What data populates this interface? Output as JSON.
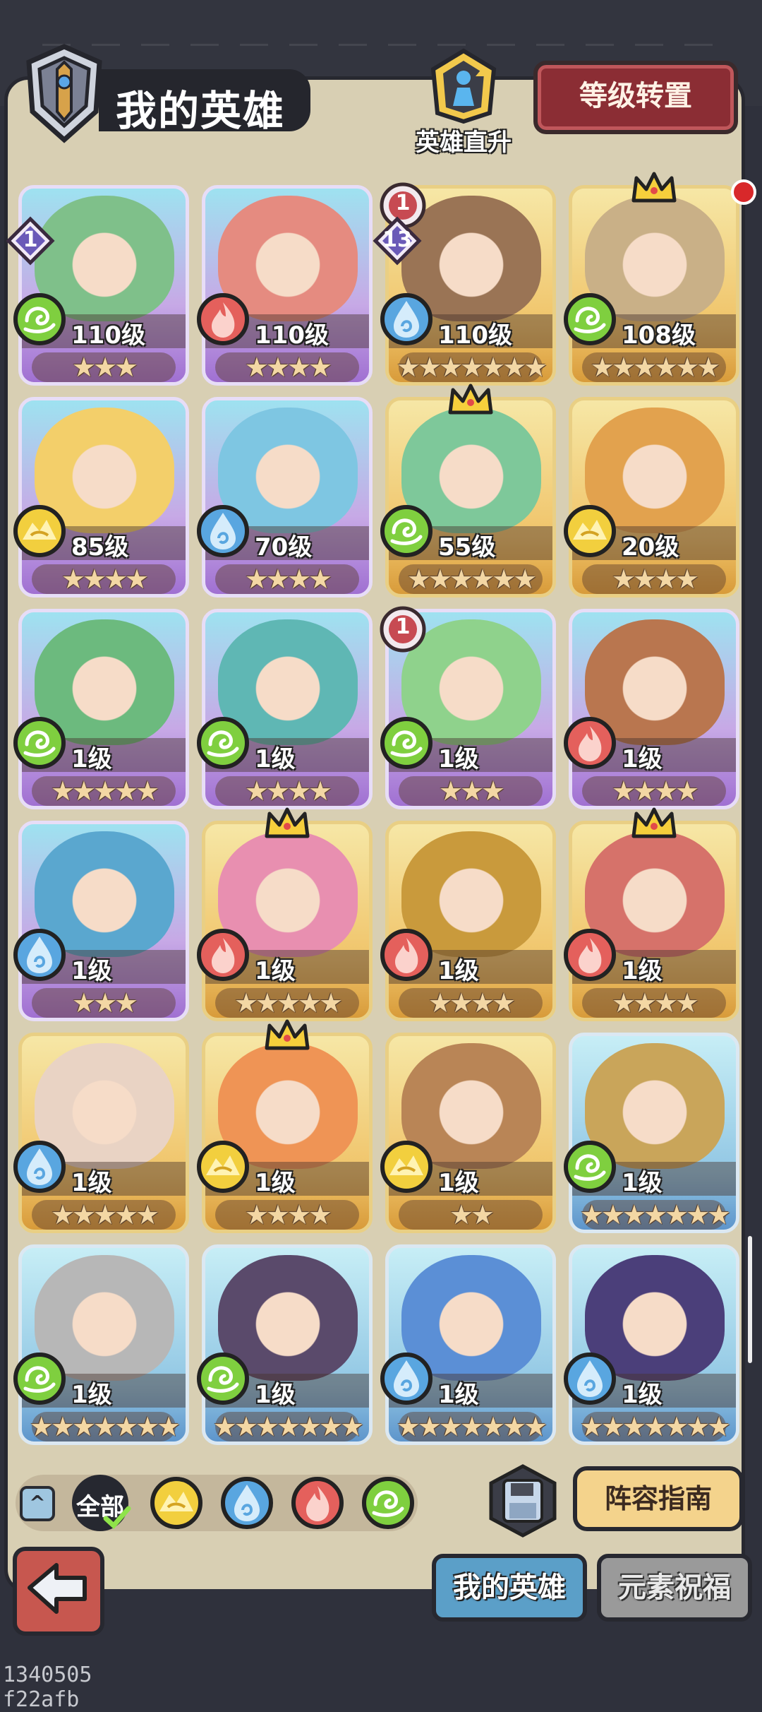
{
  "header": {
    "title": "我的英雄",
    "upgrade_label": "英雄直升",
    "transfer_label": "等级转置"
  },
  "heroes": [
    {
      "level": "110级",
      "stars": "★★★",
      "element": "wind",
      "frame": "purple",
      "rank_left": "1",
      "portrait": "#7fc08a"
    },
    {
      "level": "110级",
      "stars": "★★★★",
      "element": "fire",
      "frame": "purple",
      "portrait": "#e58b80"
    },
    {
      "level": "110级",
      "stars": "★★★★★★★",
      "element": "water",
      "frame": "gold",
      "rank_top": "1",
      "rank_left": "13",
      "portrait": "#9a7455"
    },
    {
      "level": "108级",
      "stars": "★★★★★★",
      "element": "wind",
      "frame": "gold",
      "crown": true,
      "reddot": true,
      "portrait": "#c9b087"
    },
    {
      "level": "85级",
      "stars": "★★★★",
      "element": "earth",
      "frame": "purple",
      "portrait": "#f3cf6a"
    },
    {
      "level": "70级",
      "stars": "★★★★",
      "element": "water",
      "frame": "purple",
      "portrait": "#7ec6e2"
    },
    {
      "level": "55级",
      "stars": "★★★★★★",
      "element": "wind",
      "frame": "gold",
      "crown": true,
      "portrait": "#7ec89a"
    },
    {
      "level": "20级",
      "stars": "★★★★",
      "element": "earth",
      "frame": "gold",
      "portrait": "#e2a24e"
    },
    {
      "level": "1级",
      "stars": "★★★★★",
      "element": "wind",
      "frame": "purple",
      "portrait": "#6cba7e"
    },
    {
      "level": "1级",
      "stars": "★★★★",
      "element": "wind",
      "frame": "purple",
      "portrait": "#5fb7b4"
    },
    {
      "level": "1级",
      "stars": "★★★",
      "element": "wind",
      "frame": "purple",
      "rank_top": "1",
      "portrait": "#8fd28c"
    },
    {
      "level": "1级",
      "stars": "★★★★",
      "element": "fire",
      "frame": "purple",
      "portrait": "#b9764f"
    },
    {
      "level": "1级",
      "stars": "★★★",
      "element": "water",
      "frame": "purple",
      "portrait": "#5aa7cf"
    },
    {
      "level": "1级",
      "stars": "★★★★★",
      "element": "fire",
      "frame": "gold",
      "crown": true,
      "portrait": "#e88fb0"
    },
    {
      "level": "1级",
      "stars": "★★★★",
      "element": "fire",
      "frame": "gold",
      "portrait": "#c99a3c"
    },
    {
      "level": "1级",
      "stars": "★★★★",
      "element": "fire",
      "frame": "gold",
      "crown": true,
      "portrait": "#d6726a"
    },
    {
      "level": "1级",
      "stars": "★★★★★",
      "element": "water",
      "frame": "gold",
      "portrait": "#e9d3c4"
    },
    {
      "level": "1级",
      "stars": "★★★★",
      "element": "earth",
      "frame": "gold",
      "crown": true,
      "portrait": "#ef9455"
    },
    {
      "level": "1级",
      "stars": "★★",
      "element": "earth",
      "frame": "gold",
      "portrait": "#b98556"
    },
    {
      "level": "1级",
      "stars": "★★★★★★★",
      "element": "wind",
      "frame": "blue",
      "portrait": "#c9a55a"
    },
    {
      "level": "1级",
      "stars": "★★★★★★★",
      "element": "wind",
      "frame": "blue",
      "portrait": "#b7b7b7"
    },
    {
      "level": "1级",
      "stars": "★★★★★★★",
      "element": "wind",
      "frame": "blue",
      "portrait": "#5a4a6b"
    },
    {
      "level": "1级",
      "stars": "★★★★★★★",
      "element": "water",
      "frame": "blue",
      "portrait": "#5b8fd6"
    },
    {
      "level": "1级",
      "stars": "★★★★★★★",
      "element": "water",
      "frame": "blue",
      "portrait": "#4b3f7a"
    }
  ],
  "filters": {
    "all_label": "全部",
    "elements": [
      "earth",
      "water",
      "fire",
      "wind"
    ]
  },
  "actions": {
    "guide_label": "阵容指南"
  },
  "tabs": [
    {
      "label": "我的英雄",
      "active": true
    },
    {
      "label": "元素祝福",
      "active": false
    }
  ],
  "element_colors": {
    "wind": "#7fcf3f",
    "fire": "#e4605c",
    "water": "#59a6e0",
    "earth": "#f2cf3e"
  },
  "watermark": "1340505 f22afb"
}
